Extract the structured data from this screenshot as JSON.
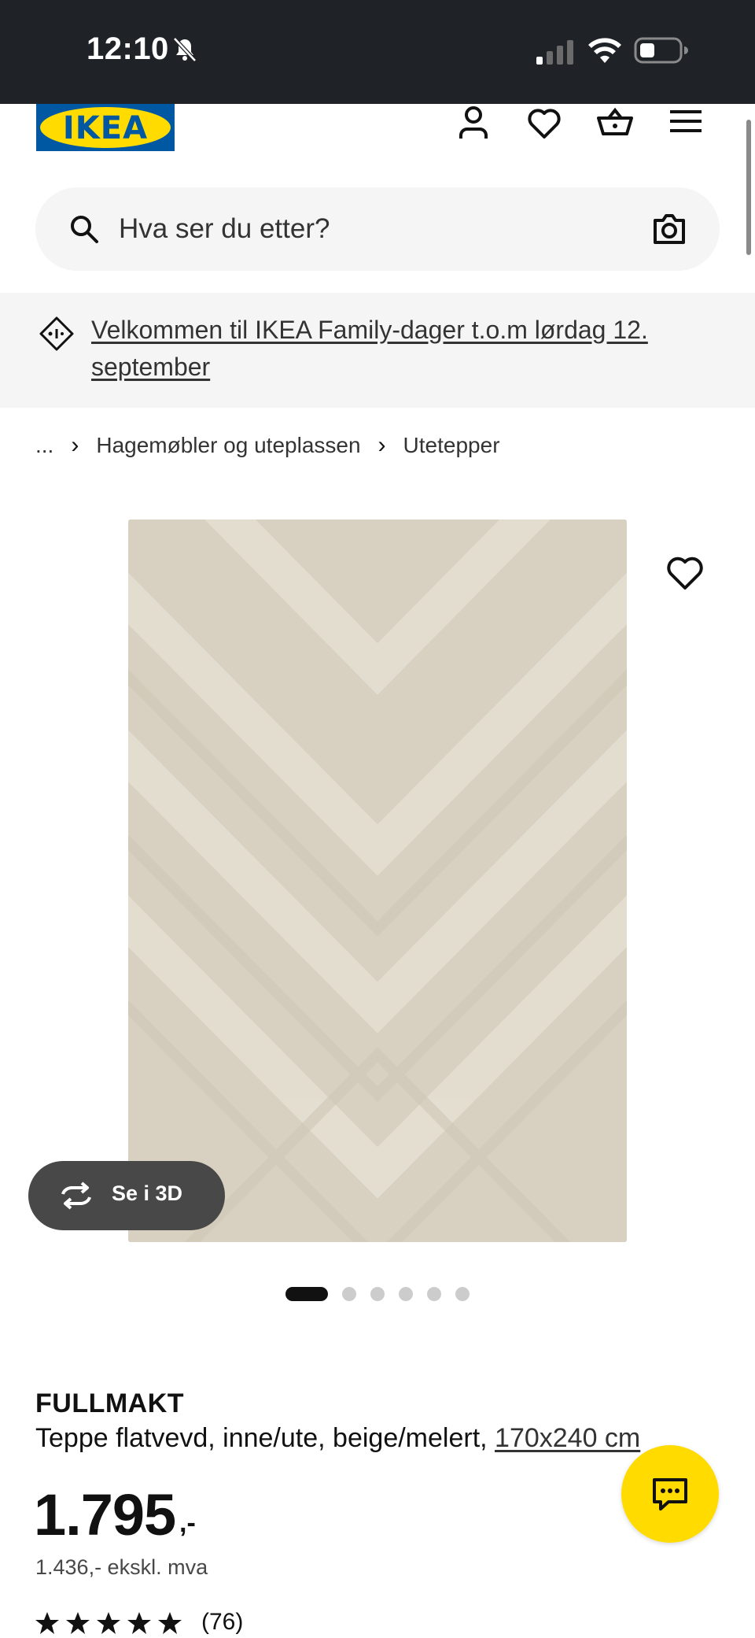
{
  "status_bar": {
    "time": "12:10"
  },
  "header": {
    "logo_text": "IKEA",
    "icons": [
      "person-icon",
      "heart-icon",
      "basket-icon",
      "menu-icon"
    ]
  },
  "search": {
    "placeholder": "Hva ser du etter?"
  },
  "banner": {
    "text": "Velkommen til IKEA Family-dager t.o.m lørdag 12. september"
  },
  "breadcrumb": {
    "ellipsis": "...",
    "items": [
      "Hagemøbler og uteplassen",
      "Utetepper"
    ]
  },
  "gallery": {
    "view_3d_label": "Se i 3D",
    "image_count": 6,
    "active_index": 0
  },
  "product": {
    "name": "FULLMAKT",
    "description": "Teppe flatvevd, inne/ute, beige/melert, ",
    "size": "170x240 cm",
    "price": "1.795",
    "price_suffix": ",-",
    "price_ex_vat": "1.436,- ekskl. mva",
    "rating": 5,
    "rating_count": "(76)"
  },
  "colors": {
    "ikea_blue": "#0058a3",
    "ikea_yellow": "#ffdb00",
    "rug": "#d9d2c2"
  }
}
